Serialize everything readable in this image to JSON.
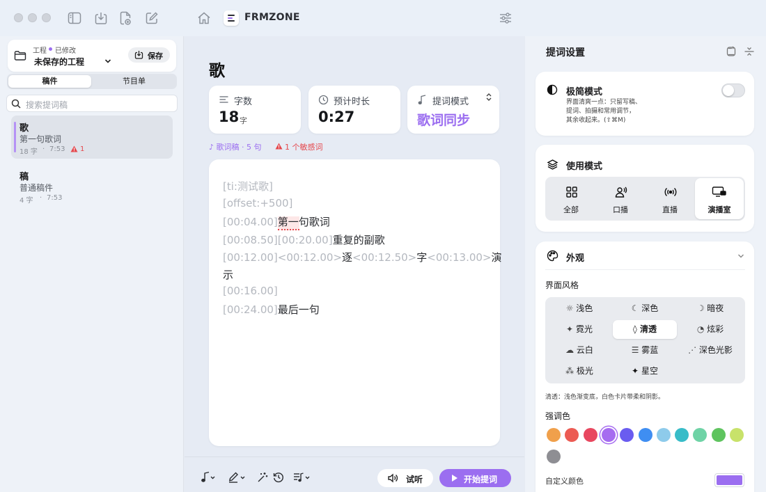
{
  "app": {
    "name": "FRMZONE"
  },
  "project": {
    "label": "工程",
    "status": "已修改",
    "name": "未保存的工程",
    "save_label": "保存"
  },
  "sidebar": {
    "tabs": [
      {
        "label": "稿件"
      },
      {
        "label": "节目单"
      }
    ],
    "search_placeholder": "搜索提词稿",
    "docs": [
      {
        "title": "歌",
        "subtitle": "第一句歌词",
        "count": "18 字",
        "time": "7:53",
        "warn": "1",
        "selected": true
      },
      {
        "title": "稿",
        "subtitle": "普通稿件",
        "count": "4 字",
        "time": "7:53",
        "warn": "",
        "selected": false
      }
    ]
  },
  "main": {
    "title": "歌",
    "stats": {
      "words": {
        "label": "字数",
        "value": "18",
        "unit": "字"
      },
      "duration": {
        "label": "预计时长",
        "value": "0:27"
      },
      "mode": {
        "label": "提词模式",
        "value": "歌词同步"
      }
    },
    "meta": {
      "kind": "歌词稿 · 5 句",
      "warning": "1 个敏感词"
    },
    "lyrics": [
      {
        "tag": "[ti:测试歌]",
        "text": ""
      },
      {
        "tag": "[offset:+500]",
        "text": ""
      },
      {
        "tag": "[00:04.00]",
        "text": "第一句歌词"
      },
      {
        "tag": "[00:08.50][00:20.00]",
        "text": "重复的副歌"
      },
      {
        "tag": "[00:12.00]<00:12.00>",
        "t1": "逐",
        "tag2": "<00:12.50>",
        "t2": "字",
        "tag3": "<00:13.00>",
        "t3": "演"
      },
      {
        "tag": "",
        "text": "示"
      },
      {
        "tag": "[00:16.00]",
        "text": ""
      },
      {
        "tag": "[00:24.00]",
        "text": "最后一句"
      }
    ],
    "bottom": {
      "listen_label": "试听",
      "start_label": "开始提词"
    }
  },
  "panel": {
    "title": "提词设置",
    "minimal": {
      "title": "极简模式",
      "desc": [
        "界面清爽一点：只留写稿、",
        "提词、拍摄和常用调节，",
        "其余收起来。(⇧⌘M)"
      ],
      "enabled": false
    },
    "usage": {
      "title": "使用模式",
      "items": [
        {
          "label": "全部"
        },
        {
          "label": "口播"
        },
        {
          "label": "直播"
        },
        {
          "label": "演播室"
        }
      ],
      "selected": "演播室"
    },
    "appearance": {
      "title": "外观",
      "style_label": "界面风格",
      "styles": [
        {
          "label": "浅色",
          "icon": "sun-icon"
        },
        {
          "label": "深色",
          "icon": "moon-icon"
        },
        {
          "label": "暗夜",
          "icon": "crescent-icon"
        },
        {
          "label": "霓光",
          "icon": "sparkle-icon"
        },
        {
          "label": "清透",
          "icon": "drop-icon"
        },
        {
          "label": "炫彩",
          "icon": "palette-icon"
        },
        {
          "label": "云白",
          "icon": "cloud-icon"
        },
        {
          "label": "雾蓝",
          "icon": "fog-icon"
        },
        {
          "label": "深色光影",
          "icon": "sunset-icon"
        },
        {
          "label": "极光",
          "icon": "aurora-icon"
        },
        {
          "label": "星空",
          "icon": "star-icon"
        }
      ],
      "selected_style": "清透",
      "style_desc": "清透：浅色渐变底，白色卡片带柔和阴影。",
      "accent_label": "强调色",
      "accents": [
        "#f0a04b",
        "#ec5b53",
        "#e8475f",
        "#a66cf0",
        "#6a5cf0",
        "#3f8ef2",
        "#8ecbeb",
        "#38bcc8",
        "#6fd3a6",
        "#5fc45f",
        "#c8e26a",
        "#8e8e93"
      ],
      "selected_accent": "#a66cf0",
      "custom_label": "自定义颜色",
      "custom_color": "#9b6ef0"
    }
  }
}
